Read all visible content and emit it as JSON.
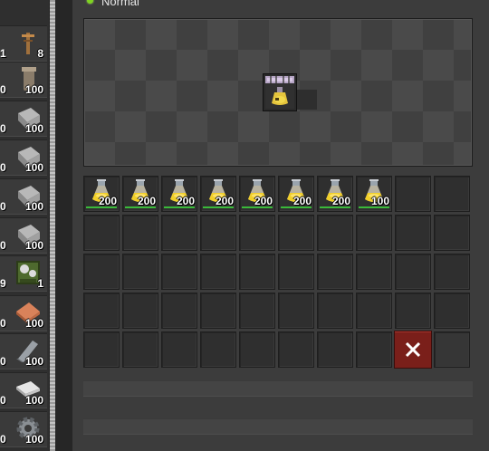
{
  "status": {
    "label": "Normal",
    "color": "#7ed321"
  },
  "left_inventory": [
    {
      "count": "8",
      "left_count": "1",
      "icon": "medium-pole-icon"
    },
    {
      "count": "100",
      "left_count": "0",
      "icon": "pipe-icon"
    },
    {
      "count": "100",
      "left_count": "0",
      "icon": "stone-brick-icon"
    },
    {
      "count": "100",
      "left_count": "0",
      "icon": "stone-brick-icon"
    },
    {
      "count": "100",
      "left_count": "0",
      "icon": "stone-brick-icon"
    },
    {
      "count": "100",
      "left_count": "0",
      "icon": "stone-brick-icon"
    },
    {
      "count": "1",
      "left_count": "9",
      "icon": "assembling-machine-icon"
    },
    {
      "count": "100",
      "left_count": "0",
      "icon": "copper-plate-icon"
    },
    {
      "count": "100",
      "left_count": "0",
      "icon": "steel-beam-icon"
    },
    {
      "count": "100",
      "left_count": "0",
      "icon": "iron-plate-icon"
    },
    {
      "count": "100",
      "left_count": "0",
      "icon": "gear-icon"
    }
  ],
  "inventory_slots": [
    {
      "count": "200",
      "item": "science-pack-icon"
    },
    {
      "count": "200",
      "item": "science-pack-icon"
    },
    {
      "count": "200",
      "item": "science-pack-icon"
    },
    {
      "count": "200",
      "item": "science-pack-icon"
    },
    {
      "count": "200",
      "item": "science-pack-icon"
    },
    {
      "count": "200",
      "item": "science-pack-icon"
    },
    {
      "count": "200",
      "item": "science-pack-icon"
    },
    {
      "count": "100",
      "item": "science-pack-icon"
    }
  ],
  "colors": {
    "bar": "#3ab93a",
    "trash": "#7a1f1a"
  }
}
